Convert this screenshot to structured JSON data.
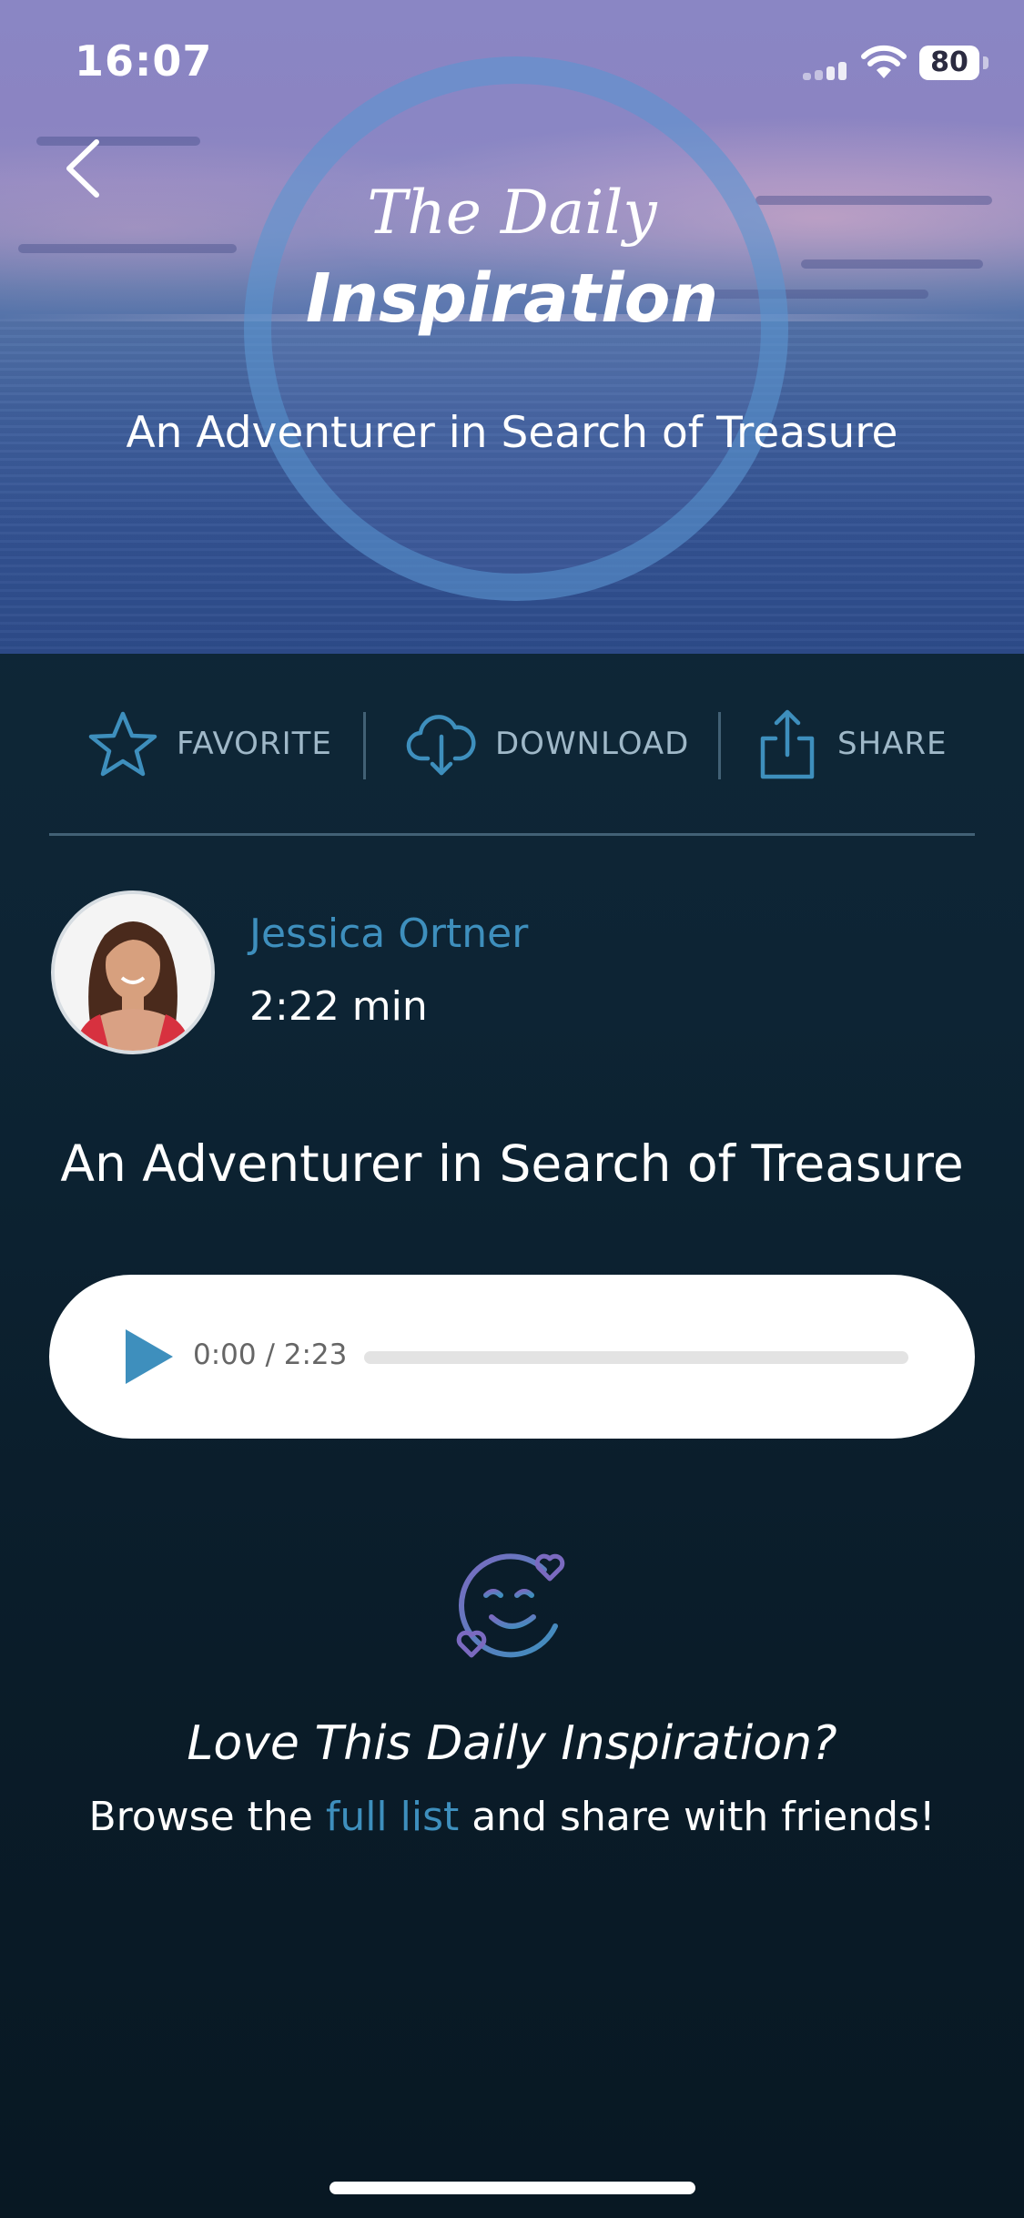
{
  "status_bar": {
    "time": "16:07",
    "battery": "80"
  },
  "hero": {
    "brand_script": "The Daily",
    "brand_main": "Inspiration",
    "subtitle": "An Adventurer in Search of Treasure"
  },
  "actions": [
    {
      "label": "FAVORITE",
      "icon": "star-icon"
    },
    {
      "label": "DOWNLOAD",
      "icon": "cloud-download-icon"
    },
    {
      "label": "SHARE",
      "icon": "share-icon"
    }
  ],
  "author": {
    "name": "Jessica Ortner",
    "duration": "2:22 min"
  },
  "episode": {
    "title": "An Adventurer in Search of Treasure"
  },
  "player": {
    "time_display": "0:00 / 2:23",
    "progress": 0
  },
  "promo": {
    "heading": "Love This Daily Inspiration?",
    "text_before": "Browse the ",
    "link": "full list",
    "text_after": " and share with friends!",
    "icon": "smiley-hearts-icon"
  },
  "colors": {
    "accent": "#3e8fbd",
    "background": "#0d2434",
    "action_label": "#9fb8c8"
  }
}
